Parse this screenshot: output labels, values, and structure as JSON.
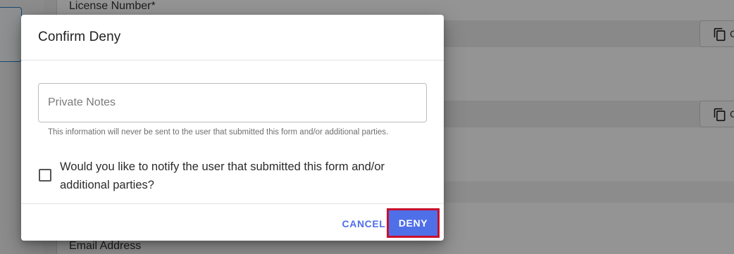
{
  "background_form": {
    "license_label": "License Number*",
    "email_label": "Email Address",
    "copy_button_text": "C"
  },
  "dialog": {
    "title": "Confirm Deny",
    "notes": {
      "placeholder": "Private Notes",
      "value": ""
    },
    "hint": "This information will never be sent to the user that submitted this form and/or additional parties.",
    "notify_checkbox": {
      "label": "Would you like to notify the user that submitted this form and/or additional parties?",
      "checked": false
    },
    "actions": {
      "cancel_label": "CANCEL",
      "deny_label": "DENY"
    }
  },
  "colors": {
    "primary": "#4f6fe8",
    "highlight_outline": "#c8102e"
  },
  "icons": {
    "copy": "copy-icon"
  }
}
